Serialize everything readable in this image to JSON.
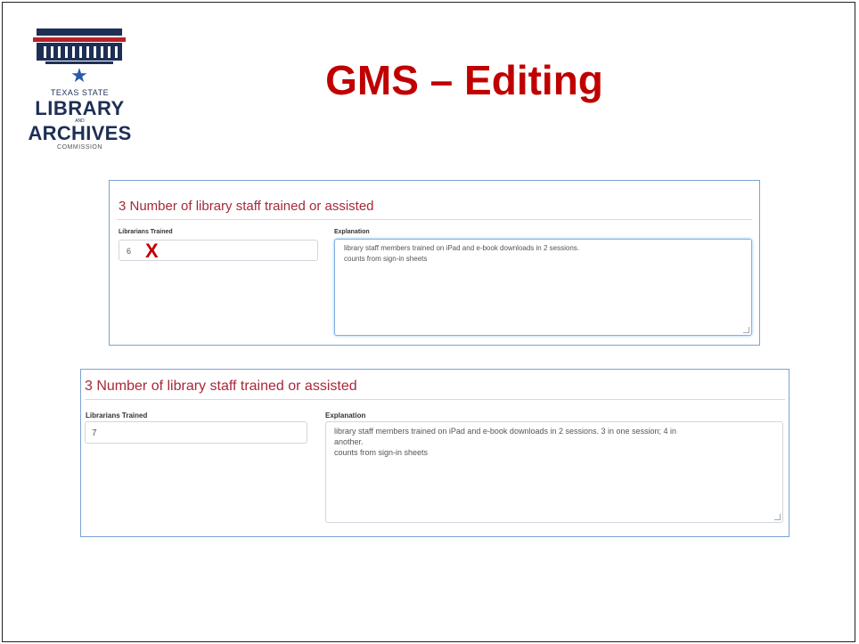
{
  "logo": {
    "line1": "TEXAS STATE",
    "line2": "LIBRARY",
    "line3": "AND",
    "line4": "ARCHIVES",
    "line5": "COMMISSION"
  },
  "slide_title": "GMS – Editing",
  "before": {
    "section_title": "3 Number of library staff trained or assisted",
    "librarians_label": "Librarians Trained",
    "librarians_value": "6",
    "mark": "X",
    "explanation_label": "Explanation",
    "explanation_line1": "library staff members trained on iPad and e-book downloads in 2 sessions.",
    "explanation_line2": "counts from sign-in sheets"
  },
  "after": {
    "section_title": "3 Number of library staff trained or assisted",
    "librarians_label": "Librarians Trained",
    "librarians_value": "7",
    "explanation_label": "Explanation",
    "explanation_line1": "library staff members trained on iPad and e-book downloads in 2 sessions. 3 in one session; 4 in",
    "explanation_line2": "another.",
    "explanation_line3": "counts from sign-in sheets"
  },
  "colors": {
    "title_red": "#c00000",
    "section_red": "#a8283a",
    "panel_border": "#7aa3d3",
    "logo_navy": "#1d2f55"
  }
}
